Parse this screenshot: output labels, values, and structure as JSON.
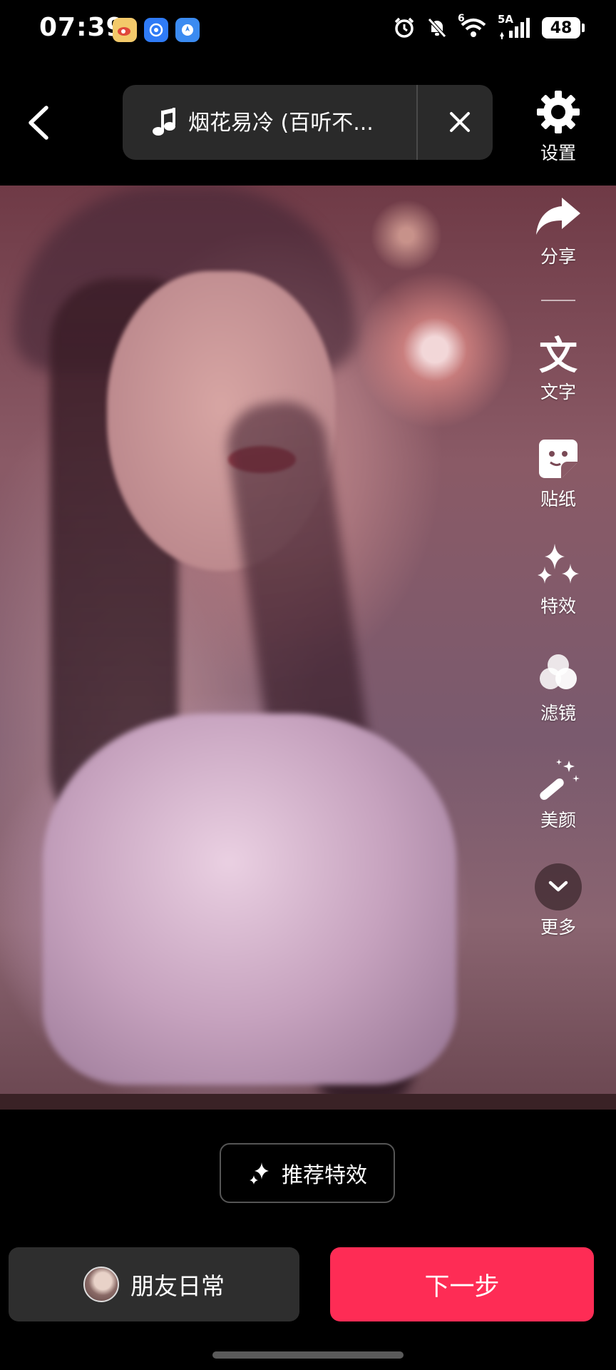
{
  "status_bar": {
    "time": "07:39",
    "network_label": "5A",
    "wifi_badge": "6",
    "battery": "48"
  },
  "top_bar": {
    "music_title": "烟花易冷 (百听不...",
    "settings_label": "设置"
  },
  "side_tools": [
    {
      "name": "share",
      "label": "分享"
    },
    {
      "name": "text",
      "label": "文字"
    },
    {
      "name": "sticker",
      "label": "贴纸"
    },
    {
      "name": "effects",
      "label": "特效"
    },
    {
      "name": "filter",
      "label": "滤镜"
    },
    {
      "name": "beauty",
      "label": "美颜"
    },
    {
      "name": "more",
      "label": "更多"
    }
  ],
  "bottom": {
    "recommend_label": "推荐特效",
    "friends_label": "朋友日常",
    "next_label": "下一步"
  },
  "colors": {
    "accent": "#fe2c55",
    "button_bg": "#2e2e2e",
    "background": "#000000"
  },
  "icons": {
    "text_glyph": "文"
  }
}
